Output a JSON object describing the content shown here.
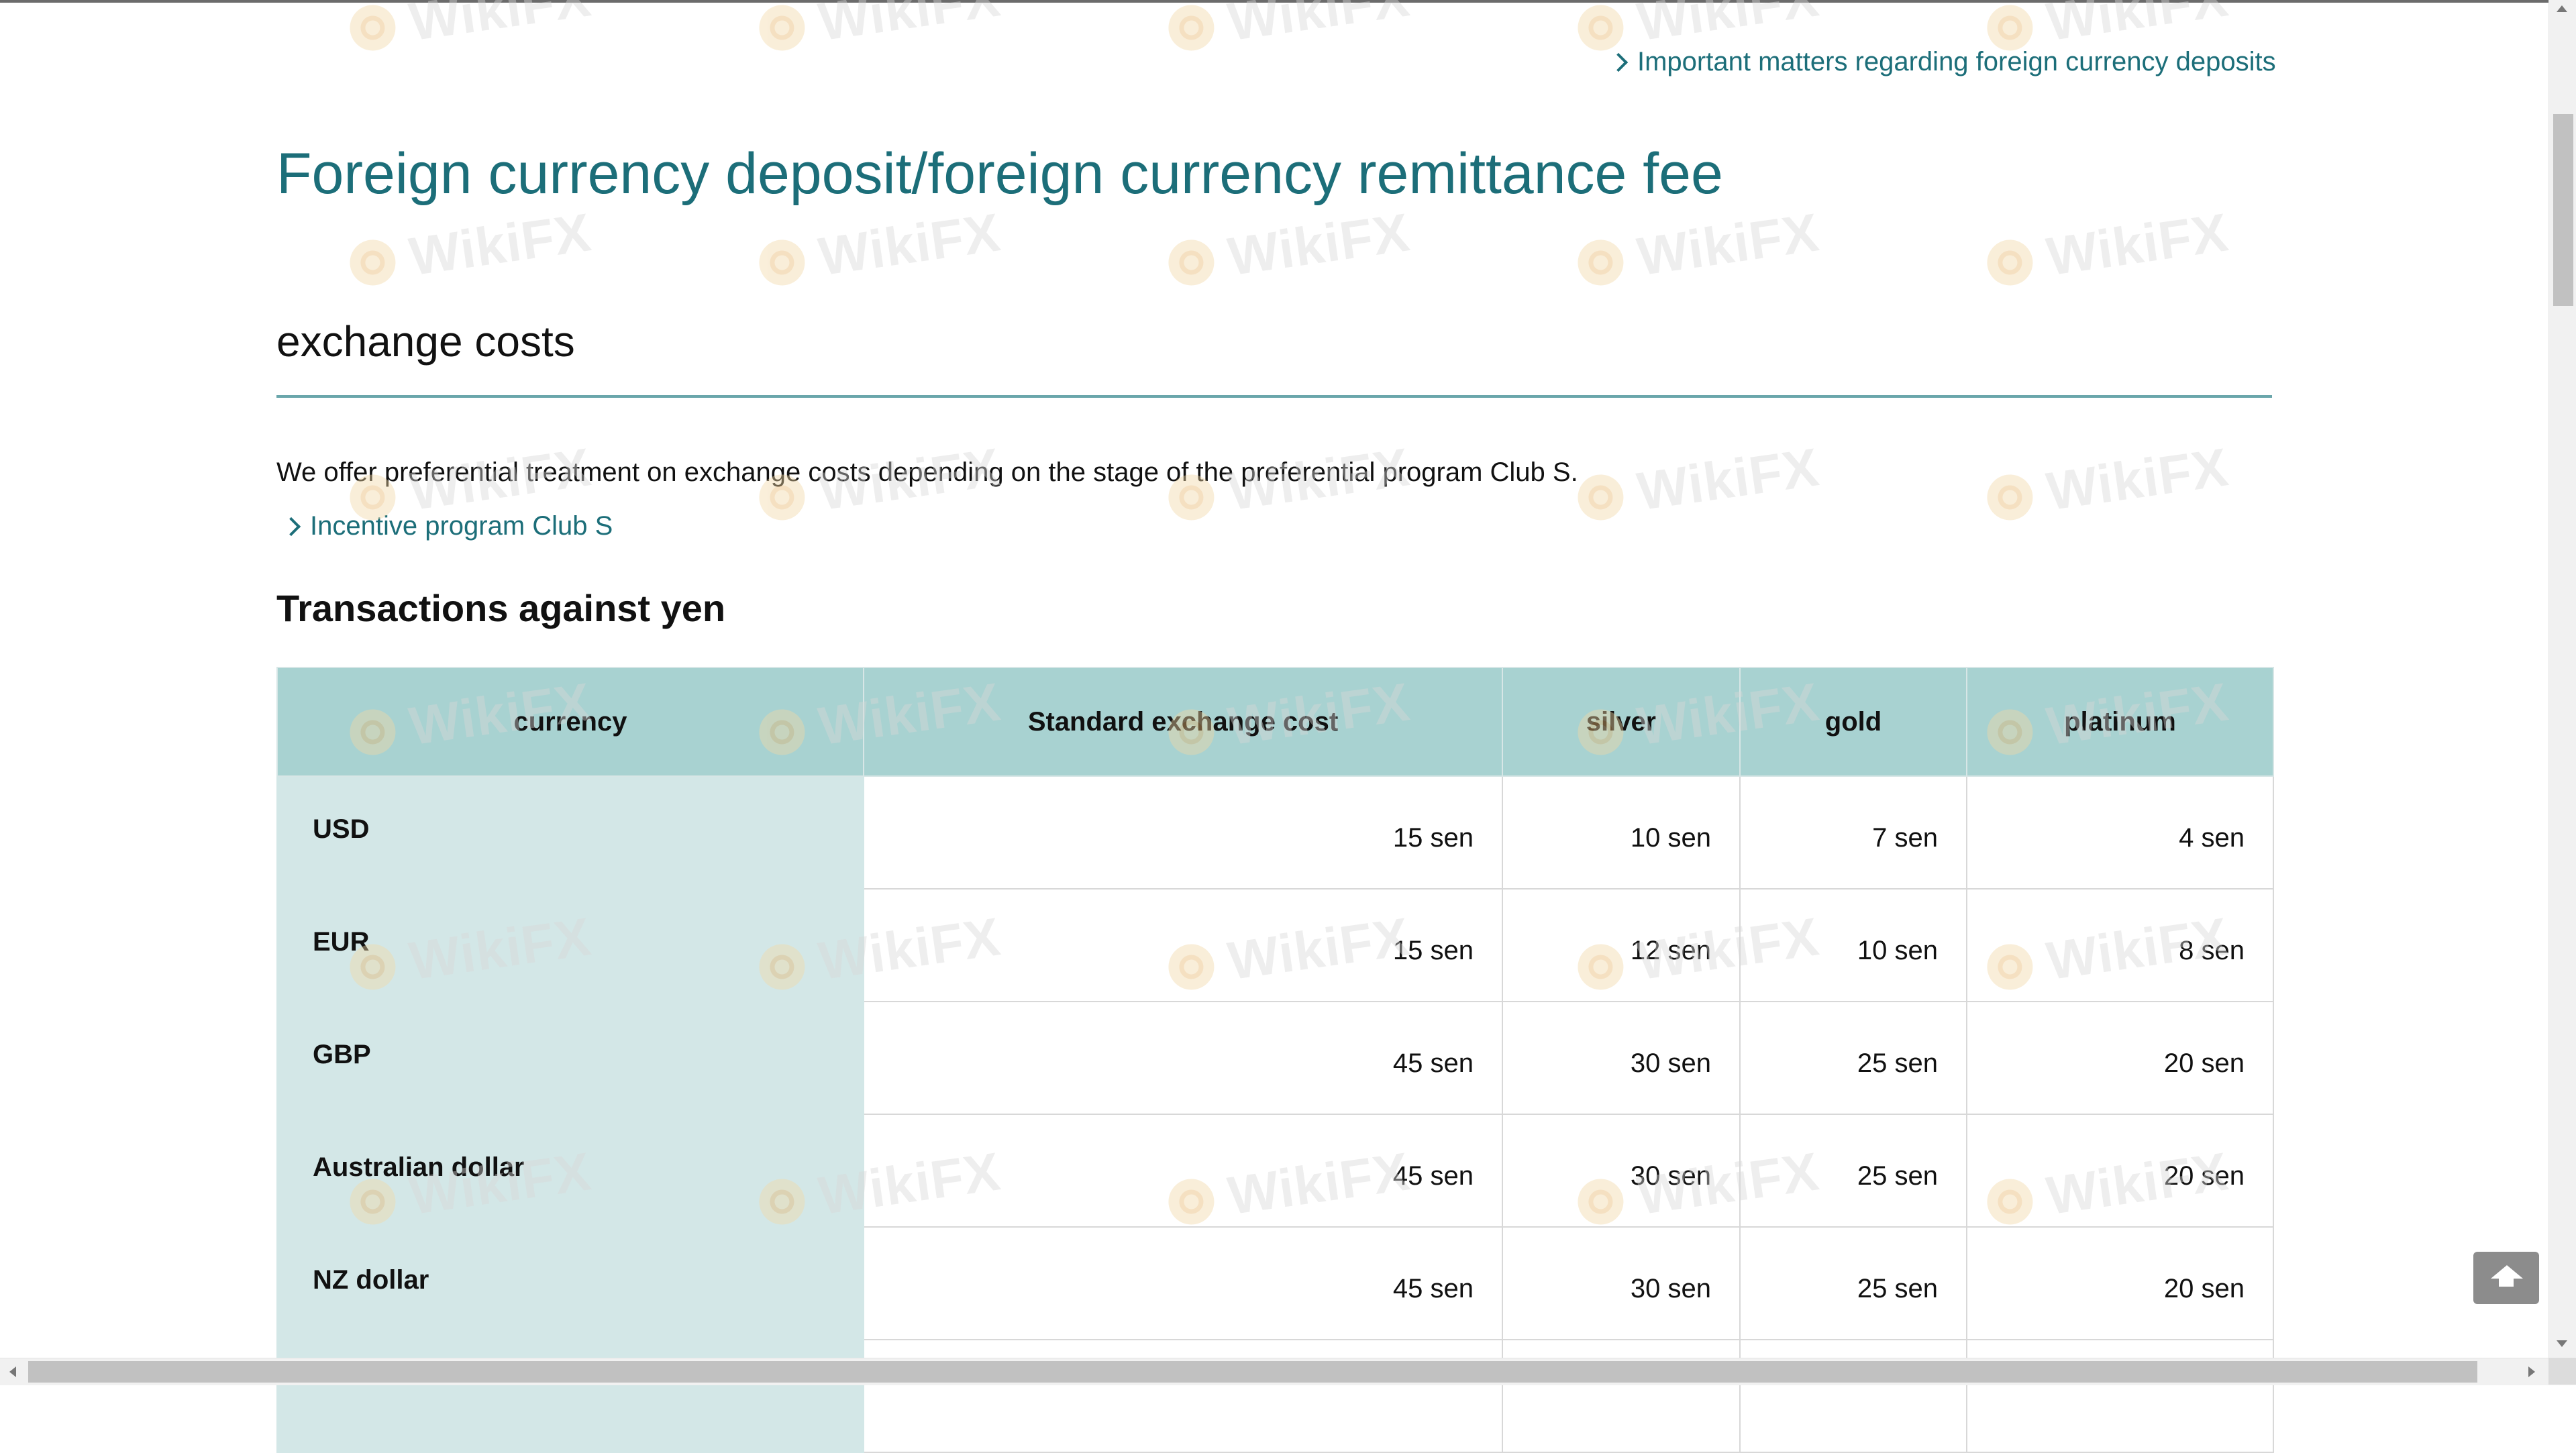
{
  "header_link": {
    "label": "Important matters regarding foreign currency deposits"
  },
  "page": {
    "title": "Foreign currency deposit/foreign currency remittance fee",
    "section_title": "exchange costs",
    "intro": "We offer preferential treatment on exchange costs depending on the stage of the preferential program Club S.",
    "club_link": "Incentive program Club S",
    "subsection_title": "Transactions against yen"
  },
  "table": {
    "headers": [
      "currency",
      "Standard exchange cost",
      "silver",
      "gold",
      "platinum"
    ],
    "rows": [
      {
        "currency": "USD",
        "standard": "15 sen",
        "silver": "10 sen",
        "gold": "7 sen",
        "platinum": "4 sen"
      },
      {
        "currency": "EUR",
        "standard": "15 sen",
        "silver": "12 sen",
        "gold": "10 sen",
        "platinum": "8 sen"
      },
      {
        "currency": "GBP",
        "standard": "45 sen",
        "silver": "30 sen",
        "gold": "25 sen",
        "platinum": "20 sen"
      },
      {
        "currency": "Australian dollar",
        "standard": "45 sen",
        "silver": "30 sen",
        "gold": "25 sen",
        "platinum": "20 sen"
      },
      {
        "currency": "NZ dollar",
        "standard": "45 sen",
        "silver": "30 sen",
        "gold": "25 sen",
        "platinum": "20 sen"
      }
    ]
  },
  "watermark": {
    "text": "WikiFX"
  },
  "controls": {
    "back_to_top_icon": "chevron-up-icon"
  },
  "colors": {
    "accent": "#1c6e79",
    "table_header": "#a8d2d1",
    "currency_column": "#d3e7e7",
    "rule": "#6aa6ab"
  }
}
